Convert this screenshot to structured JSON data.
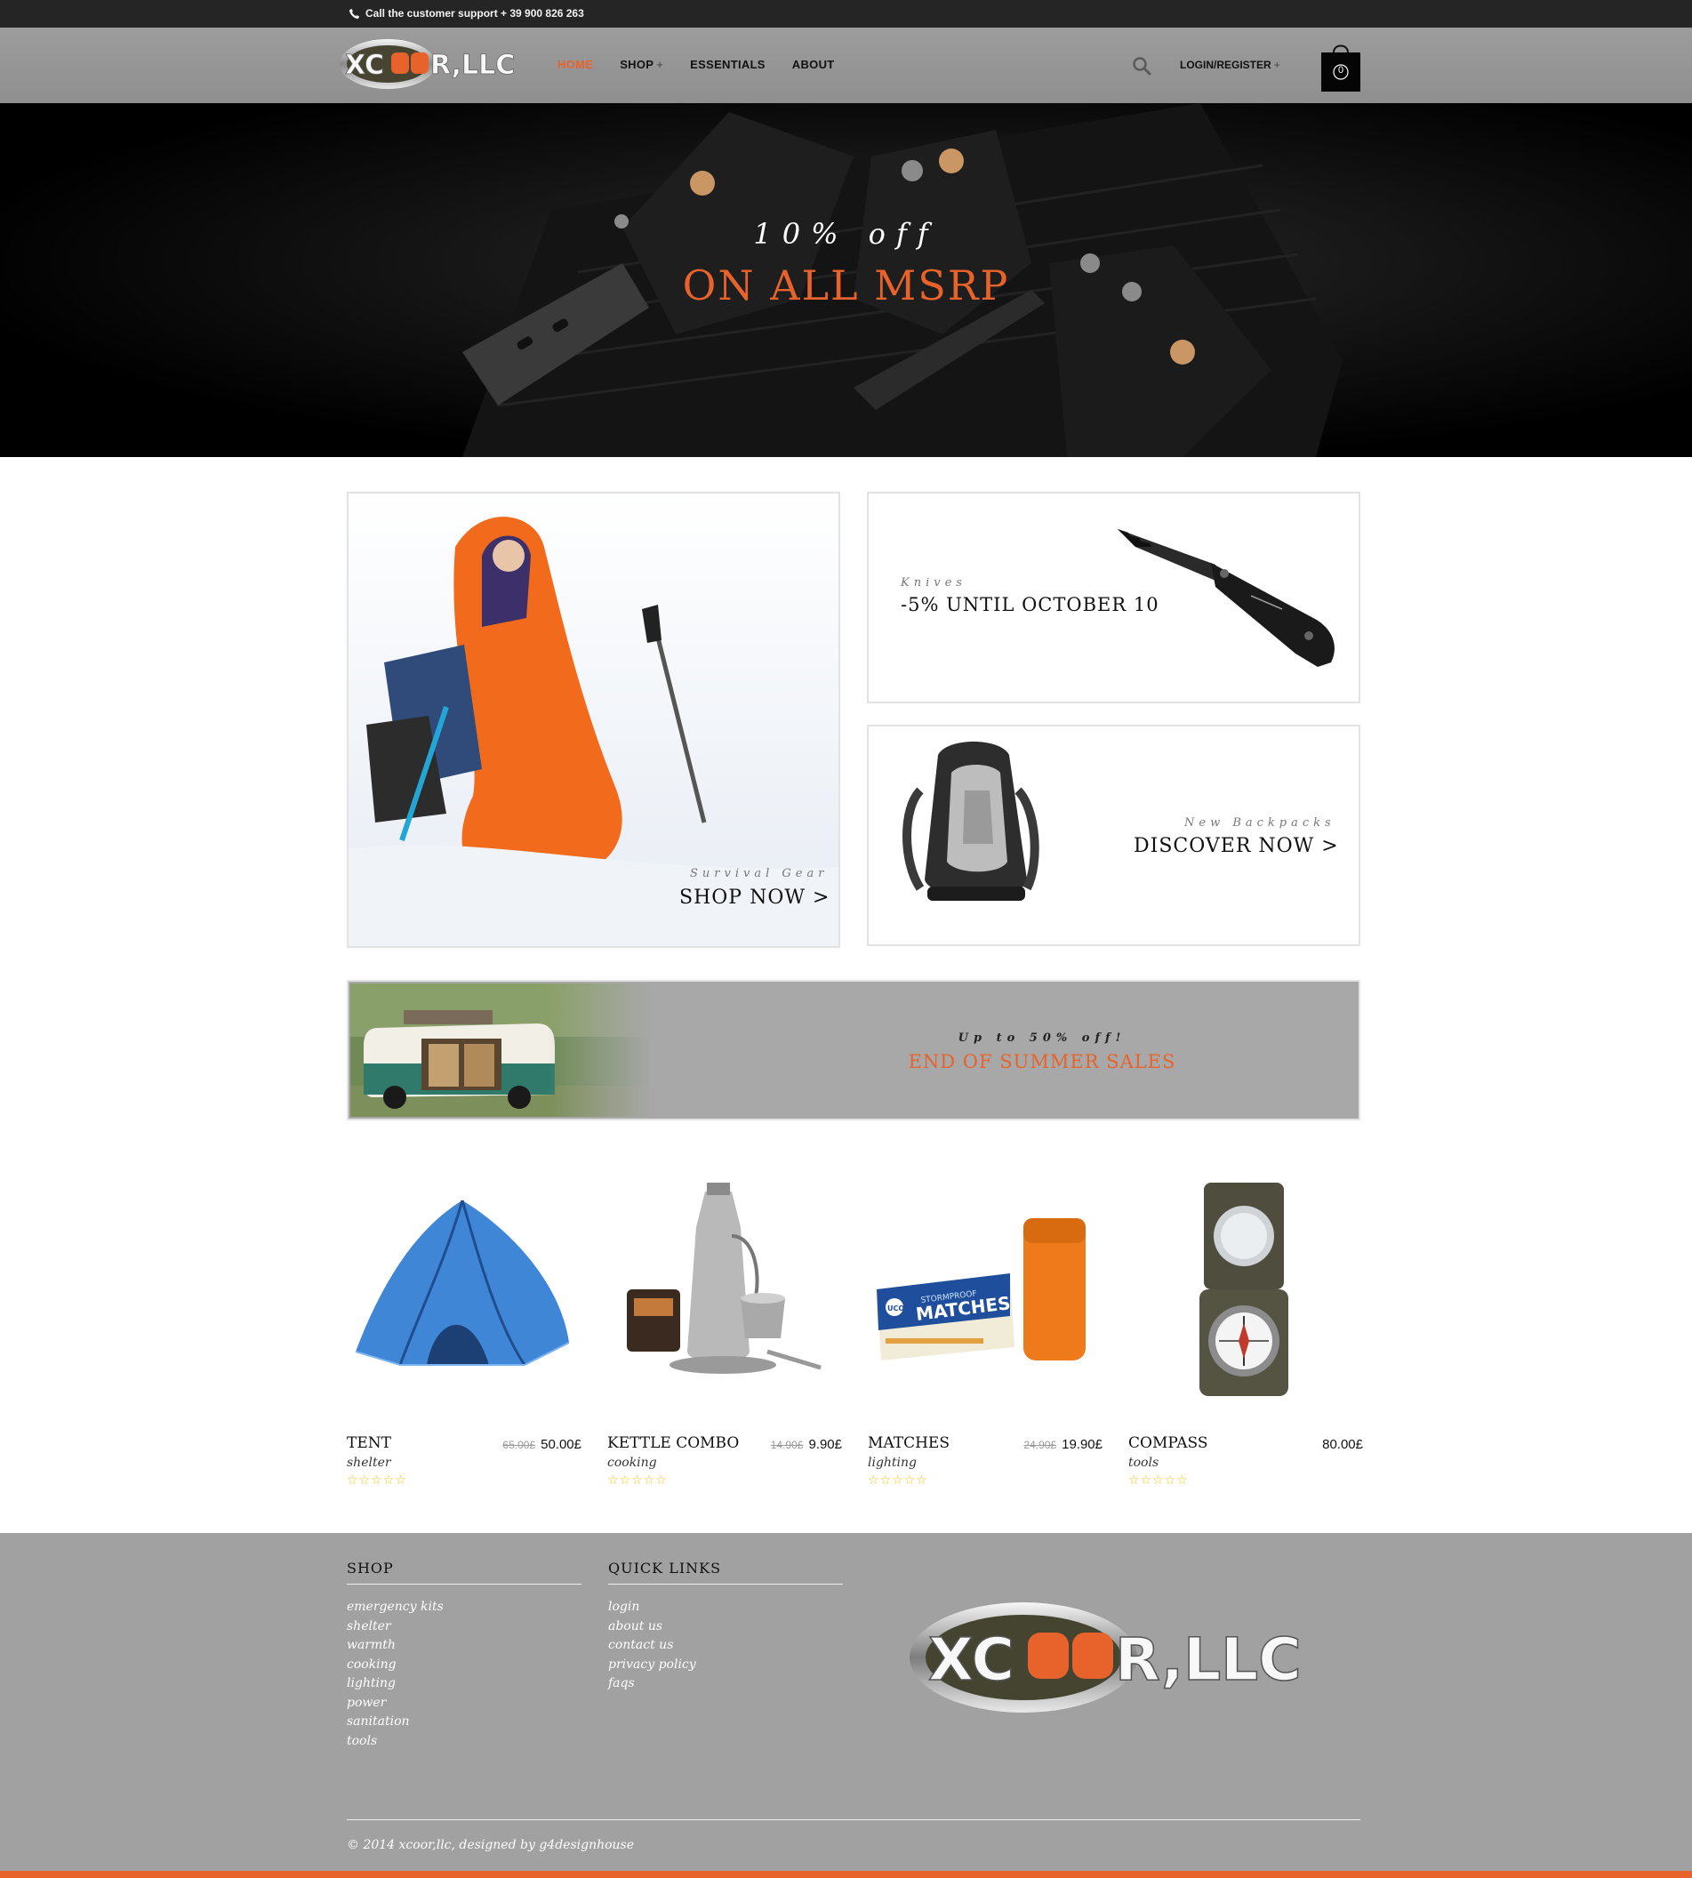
{
  "topbar": {
    "support_text": "Call the customer support + 39 900 826 263"
  },
  "header": {
    "logo_text": "XCOOR,LLC",
    "nav": [
      {
        "label": "HOME",
        "active": true,
        "has_submenu": false
      },
      {
        "label": "SHOP",
        "active": false,
        "has_submenu": true
      },
      {
        "label": "ESSENTIALS",
        "active": false,
        "has_submenu": false
      },
      {
        "label": "ABOUT",
        "active": false,
        "has_submenu": false
      }
    ],
    "submenu_marker": "+",
    "login_label": "LOGIN/REGISTER",
    "cart_count": "0"
  },
  "hero": {
    "pre_title": "10% off",
    "title": "ON ALL MSRP"
  },
  "promos": {
    "survival": {
      "kicker": "Survival Gear",
      "link": "SHOP NOW >"
    },
    "knives": {
      "kicker": "Knives",
      "headline": "-5% UNTIL OCTOBER 10"
    },
    "backpacks": {
      "kicker": "New Backpacks",
      "link": "DISCOVER NOW >"
    }
  },
  "summer_banner": {
    "pre_title": "Up to 50% off!",
    "title": "END OF SUMMER SALES"
  },
  "products": [
    {
      "name": "TENT",
      "category": "shelter",
      "old_price": "65.00£",
      "price": "50.00£",
      "stars": "☆☆☆☆☆",
      "rating": 0
    },
    {
      "name": "KETTLE COMBO",
      "category": "cooking",
      "old_price": "14.90£",
      "price": "9.90£",
      "stars": "☆☆☆☆☆",
      "rating": 0
    },
    {
      "name": "MATCHES",
      "category": "lighting",
      "old_price": "24.90£",
      "price": "19.90£",
      "stars": "☆☆☆☆☆",
      "rating": 0
    },
    {
      "name": "COMPASS",
      "category": "tools",
      "old_price": "",
      "price": "80.00£",
      "stars": "☆☆☆☆☆",
      "rating": 0
    }
  ],
  "product_images": [
    "STORMPROOF",
    "MATCHES",
    "UCO"
  ],
  "footer": {
    "shop": {
      "heading": "SHOP",
      "links": [
        "emergency kits",
        "shelter",
        "warmth",
        "cooking",
        "lighting",
        "power",
        "sanitation",
        "tools"
      ]
    },
    "quick_links": {
      "heading": "QUICK LINKS",
      "links": [
        "login",
        "about us",
        "contact us",
        "privacy policy",
        "faqs"
      ]
    },
    "logo_text": "XCOOR,LLC",
    "copyright": "© 2014 xcoor,llc, designed by g4designhouse"
  },
  "colors": {
    "accent": "#e8632b",
    "topbar": "#252525",
    "header": "#969696",
    "footer": "#a1a1a1"
  }
}
